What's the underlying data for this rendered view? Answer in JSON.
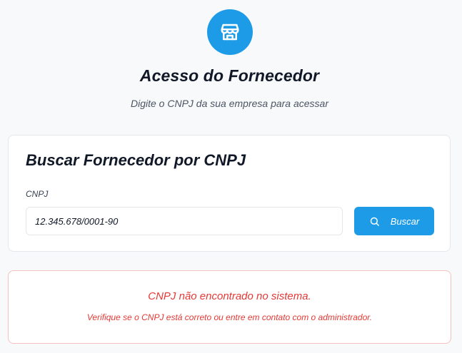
{
  "header": {
    "logo_icon": "store-icon",
    "title": "Acesso do Fornecedor",
    "subtitle": "Digite o CNPJ da sua empresa para acessar"
  },
  "search_card": {
    "title": "Buscar Fornecedor por CNPJ",
    "field_label": "CNPJ",
    "cnpj_value": "12.345.678/0001-90",
    "button_label": "Buscar",
    "button_icon": "search-icon"
  },
  "error": {
    "title": "CNPJ não encontrado no sistema.",
    "detail": "Verifique se o CNPJ está correto ou entre em contato com o administrador."
  },
  "colors": {
    "accent": "#1e9be7",
    "error": "#e53935",
    "error_border": "#f6c1c1",
    "background": "#f8f9fb"
  }
}
